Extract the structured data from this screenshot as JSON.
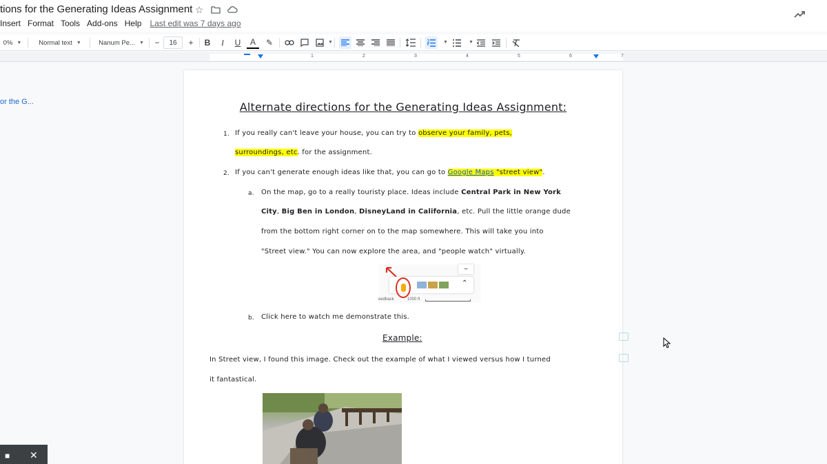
{
  "document": {
    "title": "tions for the Generating Ideas Assignment"
  },
  "menu": {
    "items": [
      "Insert",
      "Format",
      "Tools",
      "Add-ons",
      "Help"
    ],
    "last_edit": "Last edit was 7 days ago"
  },
  "toolbar": {
    "zoom": "0%",
    "style": "Normal text",
    "font": "Nanum Pe...",
    "font_size": "16",
    "minus": "−",
    "plus": "+"
  },
  "ruler": {
    "numbers": [
      "1",
      "2",
      "3",
      "4",
      "5",
      "6",
      "7"
    ]
  },
  "outline": {
    "item": "or the G..."
  },
  "content": {
    "heading": "Alternate directions for the Generating Ideas Assignment:",
    "item1_num": "1.",
    "item1_a": "If you really can't leave your house, you can try to ",
    "item1_hl1": "observe your family, pets,",
    "item1_hl2": "surroundings, etc",
    "item1_b": ". for the assignment.",
    "item2_num": "2.",
    "item2_a": "If you can't generate enough ideas like that, you can go to ",
    "item2_link": "Google Maps",
    "item2_hl": " \"street view\"",
    "item2_end": ".",
    "sub_a_num": "a.",
    "sub_a_1": "On the map, go to a really touristy place. Ideas include ",
    "sub_a_b1": "Central Park in New York",
    "sub_a_b2": "City",
    "sub_a_c1": ", ",
    "sub_a_b3": "Big Ben in London",
    "sub_a_c2": ", ",
    "sub_a_b4": "DisneyLand in California",
    "sub_a_2": ", etc. Pull the little orange dude",
    "sub_a_3": "from the bottom right corner on to the map somewhere. This will take you into",
    "sub_a_4": "\"Street view.\" You can now explore the area, and \"people watch\" virtually.",
    "sub_b_num": "b.",
    "sub_b": "Click here to watch me demonstrate this.",
    "example": "Example:",
    "para1": "In Street view, I found this image. Check out the example of what I viewed versus how I turned",
    "para2": "it fantastical.",
    "map_feedback": "eedback",
    "map_scale": "1000 ft"
  }
}
